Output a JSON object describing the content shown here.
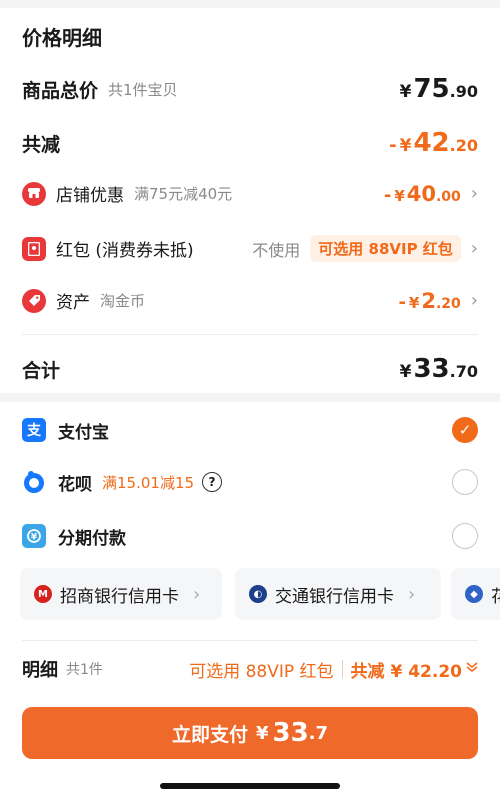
{
  "price_section": {
    "title": "价格明细",
    "total": {
      "label": "商品总价",
      "sub": "共1件宝贝",
      "yen": "¥",
      "int": "75",
      "dec": ".90"
    },
    "reduce": {
      "label": "共减",
      "minus": "-",
      "yen": "¥",
      "int": "42",
      "dec": ".20"
    },
    "store_discount": {
      "icon": "store-icon",
      "label": "店铺优惠",
      "sub": "满75元减40元",
      "minus": "-",
      "yen": "¥",
      "int": "40",
      "dec": ".00"
    },
    "red_packet": {
      "icon": "red-packet-icon",
      "label": "红包 (消费券未抵)",
      "status": "不使用",
      "chip": "可选用 88VIP 红包"
    },
    "assets": {
      "icon": "coin-tag-icon",
      "label": "资产",
      "sub": "淘金币",
      "minus": "-",
      "yen": "¥",
      "int": "2",
      "dec": ".20"
    },
    "sum": {
      "label": "合计",
      "yen": "¥",
      "int": "33",
      "dec": ".70"
    }
  },
  "payment": {
    "methods": [
      {
        "icon": "alipay-icon",
        "label": "支付宝",
        "promo": "",
        "selected": true
      },
      {
        "icon": "huabei-icon",
        "label": "花呗",
        "promo": "满15.01减15",
        "selected": false
      },
      {
        "icon": "installment-icon",
        "label": "分期付款",
        "promo": "",
        "selected": false
      }
    ],
    "banks": [
      {
        "icon": "cmb-icon",
        "label": "招商银行信用卡"
      },
      {
        "icon": "bocom-icon",
        "label": "交通银行信用卡"
      },
      {
        "icon": "bank-icon",
        "label": "花"
      }
    ]
  },
  "detail": {
    "title": "明细",
    "count": "共1件",
    "vip": "可选用 88VIP 红包",
    "save": "共减 ¥ 42.20"
  },
  "pay_button": {
    "label": "立即支付",
    "yen": "¥",
    "int": "33",
    "dec": ".7"
  },
  "colors": {
    "accent": "#f06a1a",
    "button": "#ef6a2a",
    "alipay": "#1677ff",
    "red": "#e8383a"
  }
}
